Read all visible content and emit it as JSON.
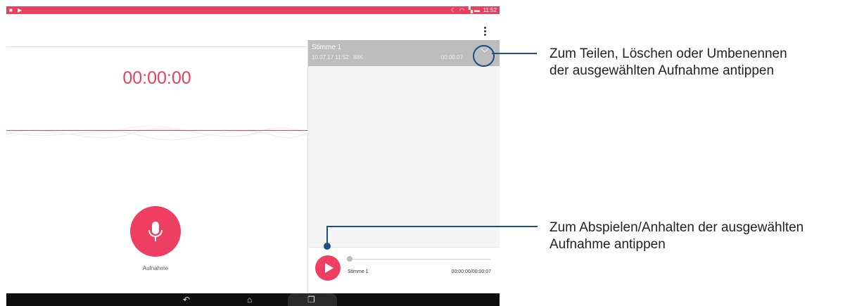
{
  "status_bar": {
    "time": "11:52"
  },
  "recorder": {
    "timer": "00:00:00",
    "record_label": "Aufnahme"
  },
  "recording_list": {
    "items": [
      {
        "name": "Stimme 1",
        "date": "10.07.17 11:52",
        "size": "88K",
        "duration": "00:00:07"
      }
    ]
  },
  "player": {
    "track_name": "Stimme 1",
    "time": "00:00:00/00:00:07",
    "progress": 0
  },
  "callouts": {
    "options_line1": "Zum Teilen, Löschen oder Umbenennen",
    "options_line2": "der ausgewählten Aufnahme antippen",
    "play_line1": "Zum Abspielen/Anhalten der ausgewählten",
    "play_line2": "Aufnahme antippen"
  },
  "colors": {
    "accent": "#ee3f63",
    "status_bar": "#e8405f",
    "callout": "#1d4e89"
  }
}
